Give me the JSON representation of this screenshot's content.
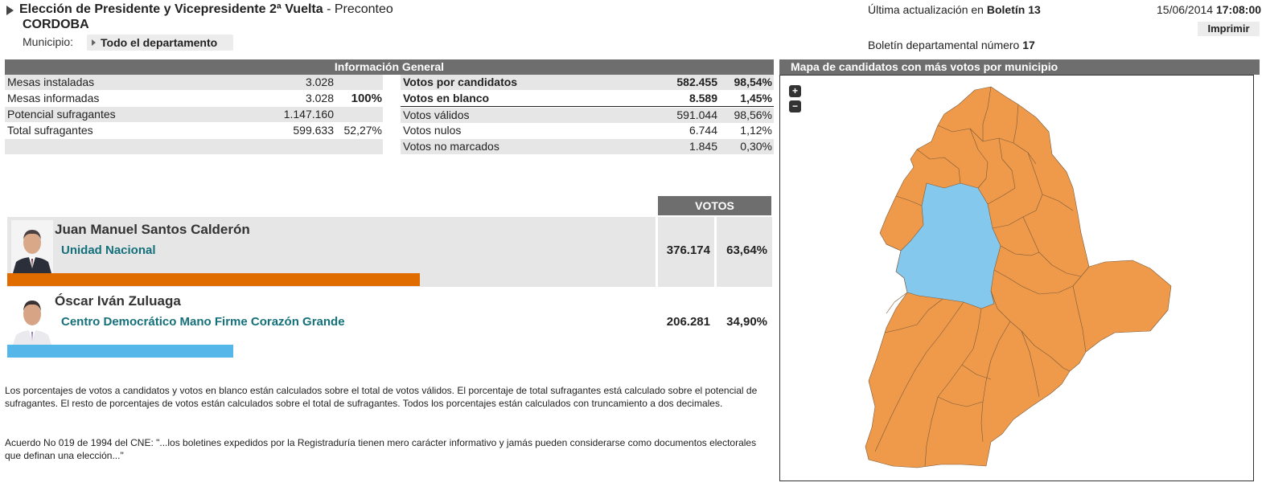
{
  "header": {
    "title": "Elección de Presidente y Vicepresidente 2ª Vuelta",
    "title_sub": " - Preconteo",
    "department": "CORDOBA",
    "municipio_label": "Municipio:",
    "municipio_value": "Todo el departamento",
    "update_label": "Última actualización en ",
    "update_value": "Boletín 13",
    "date": "15/06/2014 ",
    "time": "17:08:00",
    "print_label": "Imprimir",
    "bulletin_label": "Boletín departamental número ",
    "bulletin_value": "17"
  },
  "info": {
    "title": "Información General",
    "left": [
      {
        "label": "Mesas instaladas",
        "value": "3.028",
        "pct": ""
      },
      {
        "label": "Mesas informadas",
        "value": "3.028",
        "pct": "100%"
      },
      {
        "label": "Potencial sufragantes",
        "value": "1.147.160",
        "pct": ""
      },
      {
        "label": "Total sufragantes",
        "value": "599.633",
        "pct": "52,27%"
      }
    ],
    "right": [
      {
        "label": "Votos por candidatos",
        "value": "582.455",
        "pct": "98,54%"
      },
      {
        "label": "Votos en blanco",
        "value": "8.589",
        "pct": "1,45%"
      },
      {
        "label": "Votos válidos",
        "value": "591.044",
        "pct": "98,56%"
      },
      {
        "label": "Votos nulos",
        "value": "6.744",
        "pct": "1,12%"
      },
      {
        "label": "Votos no marcados",
        "value": "1.845",
        "pct": "0,30%"
      }
    ]
  },
  "votes": {
    "header": "VOTOS",
    "candidates": [
      {
        "name": "Juan Manuel Santos Calderón",
        "party": "Unidad Nacional",
        "votes": "376.174",
        "pct": "63,64%",
        "bar_pct": 63.64,
        "color": "#e06c00"
      },
      {
        "name": "Óscar Iván Zuluaga",
        "party": "Centro Democrático Mano Firme Corazón Grande",
        "votes": "206.281",
        "pct": "34,90%",
        "bar_pct": 34.9,
        "color": "#55b6ea"
      }
    ]
  },
  "notes": {
    "n1": "Los porcentajes de votos a candidatos y votos en blanco están calculados sobre el total de votos válidos. El porcentaje de total sufragantes está calculado sobre el potencial de sufragantes. El resto de porcentajes de votos están calculados sobre el total de sufragantes. Todos los porcentajes están calculados con truncamiento a dos decimales.",
    "n2": "Acuerdo No 019 de 1994 del CNE: \"...los boletines expedidos por la Registraduría tienen mero carácter informativo y jamás pueden considerarse como documentos electorales que definan una elección...\""
  },
  "map": {
    "title": "Mapa de candidatos con más votos por municipio",
    "zoom_in": "+",
    "zoom_out": "−",
    "color_santos": "#ef9a4a",
    "color_zuluaga": "#85c8ee"
  }
}
